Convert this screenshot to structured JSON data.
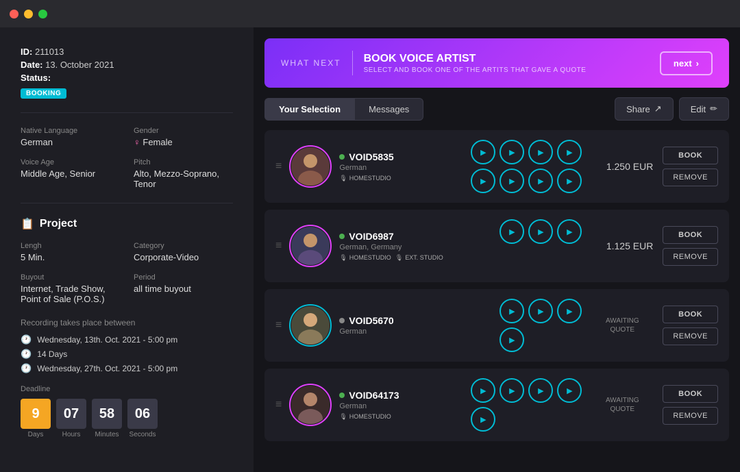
{
  "titlebar": {
    "lights": [
      "red",
      "yellow",
      "green"
    ]
  },
  "left": {
    "id_label": "ID:",
    "id_value": "211013",
    "date_label": "Date:",
    "date_value": "13. October 2021",
    "status_label": "Status:",
    "status_badge": "BOOKING",
    "native_language_label": "Native Language",
    "native_language": "German",
    "gender_label": "Gender",
    "gender_icon": "♀",
    "gender": "Female",
    "voice_age_label": "Voice Age",
    "voice_age": "Middle Age, Senior",
    "pitch_label": "Pitch",
    "pitch": "Alto, Mezzo-Soprano, Tenor",
    "project_label": "Project",
    "length_label": "Lengh",
    "length_value": "5 Min.",
    "category_label": "Category",
    "category_value": "Corporate-Video",
    "buyout_label": "Buyout",
    "buyout_value": "Internet, Trade Show, Point of Sale (P.O.S.)",
    "period_label": "Period",
    "period_value": "all time buyout",
    "recording_label": "Recording takes place between",
    "recording_start": "Wednesday, 13th. Oct. 2021 - 5:00 pm",
    "recording_duration": "14 Days",
    "recording_end": "Wednesday, 27th. Oct. 2021 - 5:00 pm",
    "deadline_label": "Deadline",
    "countdown": {
      "days": "9",
      "days_label": "Days",
      "hours": "07",
      "hours_label": "Hours",
      "minutes": "58",
      "minutes_label": "Minutes",
      "seconds": "06",
      "seconds_label": "Seconds"
    }
  },
  "banner": {
    "what_next": "WHAT NEXT",
    "divider": "|",
    "title": "BOOK VOICE ARTIST",
    "subtitle": "SELECT AND BOOK ONE OF THE ARTITS THAT GAVE A QUOTE",
    "next_label": "next"
  },
  "tabs": {
    "your_selection": "Your Selection",
    "messages": "Messages",
    "share": "Share",
    "edit": "Edit"
  },
  "artists": [
    {
      "id": "VOID5835",
      "lang": "German",
      "tags": [
        "HOMESTUDIO"
      ],
      "status_dot": "green",
      "price": "1.250 EUR",
      "awaiting": false,
      "play_count": 4
    },
    {
      "id": "VOID6987",
      "lang": "German, Germany",
      "tags": [
        "HOMESTUDIO",
        "EXT. STUDIO"
      ],
      "status_dot": "green",
      "price": "1.125 EUR",
      "awaiting": false,
      "play_count": 3
    },
    {
      "id": "VOID5670",
      "lang": "German",
      "tags": [],
      "status_dot": "gray",
      "price": "AWAITING QUOTE",
      "awaiting": true,
      "play_count": 3
    },
    {
      "id": "VOID64173",
      "lang": "German",
      "tags": [
        "HOMESTUDIO"
      ],
      "status_dot": "green",
      "price": "AWAITING QUOTE",
      "awaiting": true,
      "play_count": 4
    }
  ],
  "buttons": {
    "book": "BOOK",
    "remove": "REMOVE"
  }
}
